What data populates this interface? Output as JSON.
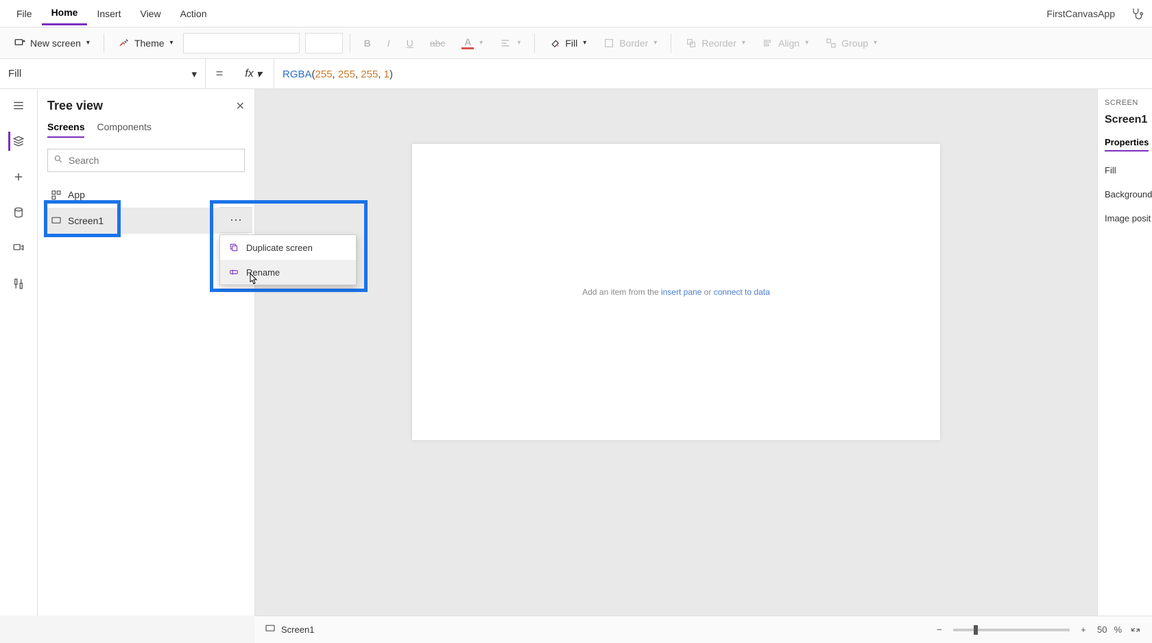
{
  "menubar": {
    "items": [
      "File",
      "Home",
      "Insert",
      "View",
      "Action"
    ],
    "activeIndex": 1,
    "appName": "FirstCanvasApp"
  },
  "ribbon": {
    "newScreen": "New screen",
    "theme": "Theme",
    "fill": "Fill",
    "border": "Border",
    "reorder": "Reorder",
    "align": "Align",
    "group": "Group"
  },
  "formulaBar": {
    "property": "Fill",
    "fx": "fx",
    "formula": {
      "fn": "RGBA",
      "args": [
        "255",
        "255",
        "255",
        "1"
      ]
    }
  },
  "treeView": {
    "title": "Tree view",
    "tabs": [
      "Screens",
      "Components"
    ],
    "activeTabIndex": 0,
    "searchPlaceholder": "Search",
    "items": [
      {
        "label": "App",
        "icon": "app"
      },
      {
        "label": "Screen1",
        "icon": "screen",
        "selected": true
      }
    ]
  },
  "contextMenu": {
    "items": [
      {
        "label": "Duplicate screen",
        "icon": "duplicate"
      },
      {
        "label": "Rename",
        "icon": "rename"
      }
    ]
  },
  "canvas": {
    "hintPrefix": "Add an item from the ",
    "hintLink1": "insert pane",
    "hintMiddle": " or ",
    "hintLink2": "connect to data"
  },
  "propertiesPanel": {
    "headerLabel": "SCREEN",
    "name": "Screen1",
    "tab": "Properties",
    "rows": [
      "Fill",
      "Background",
      "Image posit"
    ]
  },
  "statusBar": {
    "screenName": "Screen1",
    "zoomValue": "50",
    "zoomUnit": "%"
  }
}
